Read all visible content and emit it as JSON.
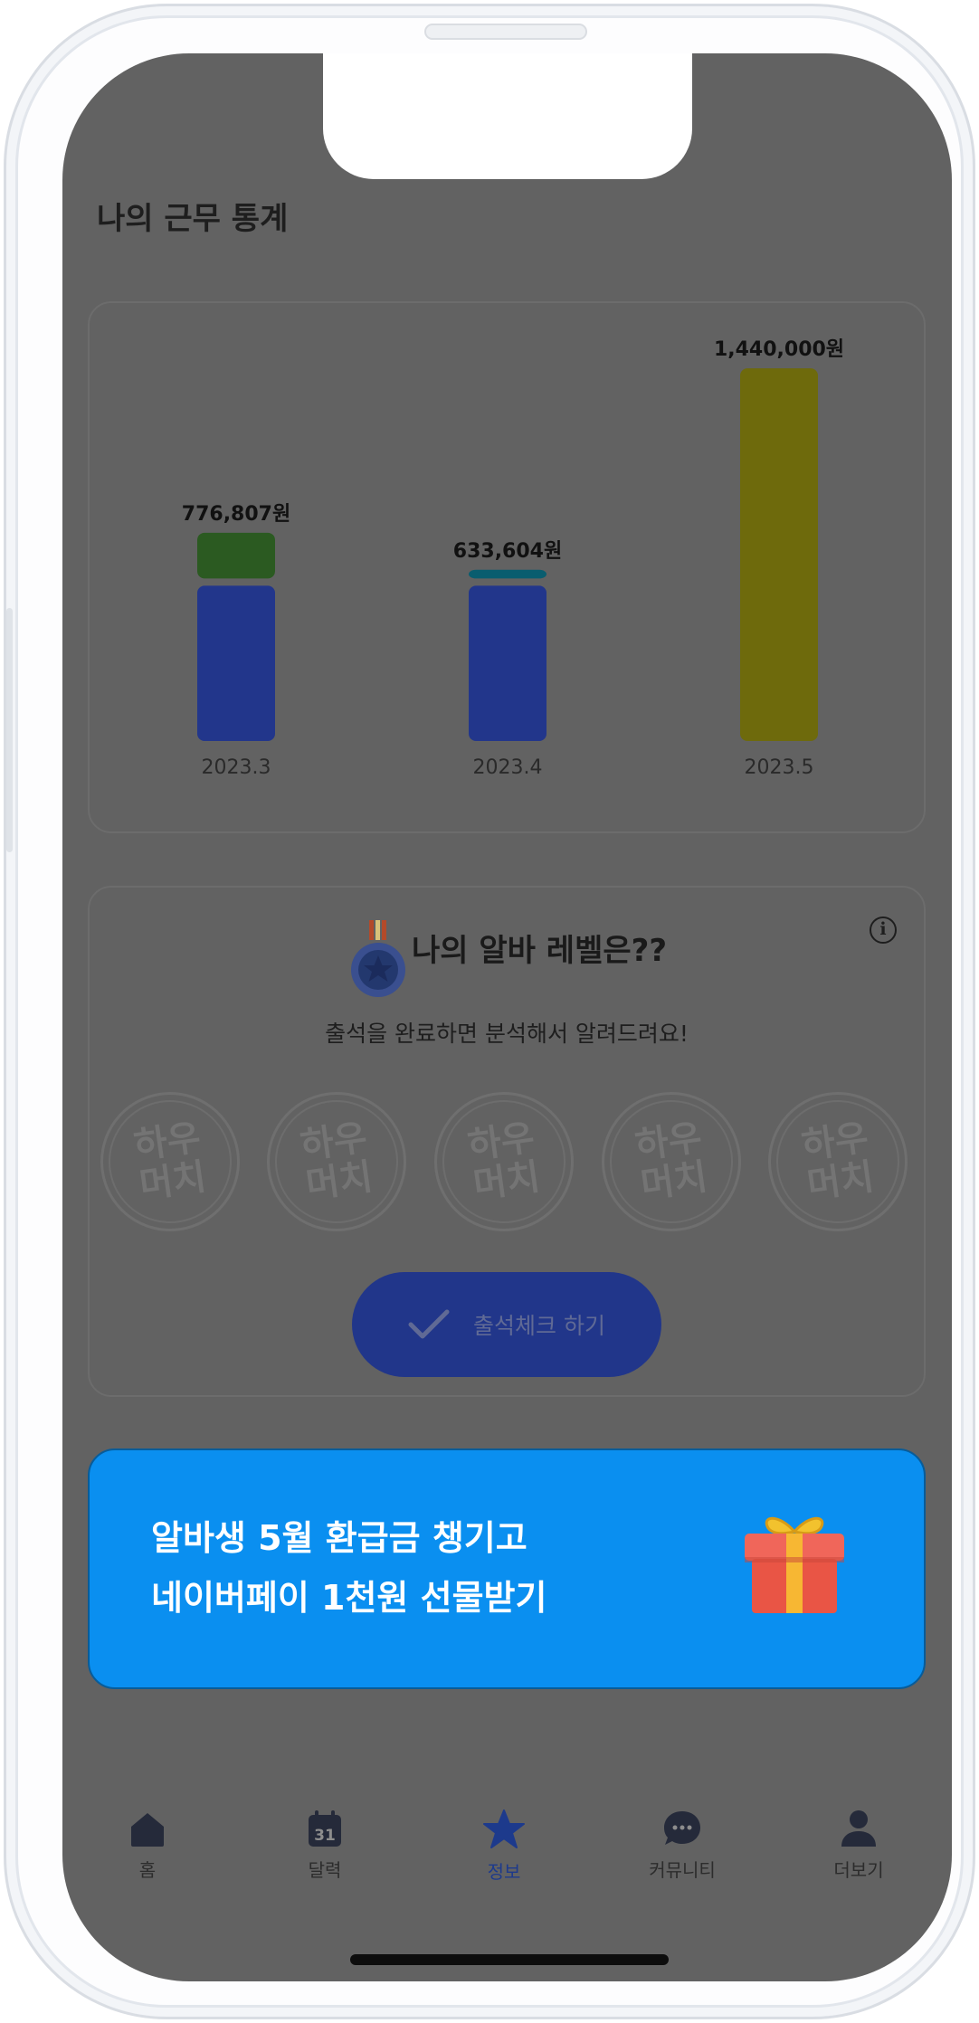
{
  "page": {
    "title": "나의 근무 통계"
  },
  "chart_data": {
    "type": "bar",
    "stacked": true,
    "categories": [
      "2023.3",
      "2023.4",
      "2023.5"
    ],
    "totals_labels": [
      "776,807원",
      "633,604원",
      "1,440,000원"
    ],
    "series": [
      {
        "values": [
          600000,
          600000,
          0
        ],
        "color": "#22368b"
      },
      {
        "values": [
          176807,
          33604,
          1440000
        ],
        "colors": [
          "#2b5a21",
          "#095d6f",
          "#6e6a0c"
        ]
      }
    ],
    "ylim": [
      0,
      1500000
    ],
    "grid": false
  },
  "level": {
    "title": "나의 알바 레벨은??",
    "subtitle": "출석을 완료하면 분석해서 알려드려요!",
    "stamps": [
      {
        "line1": "하우",
        "line2": "머치"
      },
      {
        "line1": "하우",
        "line2": "머치"
      },
      {
        "line1": "하우",
        "line2": "머치"
      },
      {
        "line1": "하우",
        "line2": "머치"
      },
      {
        "line1": "하우",
        "line2": "머치"
      }
    ],
    "check_button_label": "출석체크 하기"
  },
  "promo": {
    "line1": "알바생 5월 환급금 챙기고",
    "line2": "네이버페이 1천원 선물받기",
    "background": "#0a8ff0"
  },
  "tabbar": {
    "active": "정보",
    "accent": "#1d3a8c",
    "tabs": [
      {
        "label": "홈",
        "icon": "home-icon"
      },
      {
        "label": "달력",
        "icon": "calendar-icon",
        "badge": "31"
      },
      {
        "label": "정보",
        "icon": "star-icon"
      },
      {
        "label": "커뮤니티",
        "icon": "chat-icon"
      },
      {
        "label": "더보기",
        "icon": "person-icon"
      }
    ]
  }
}
